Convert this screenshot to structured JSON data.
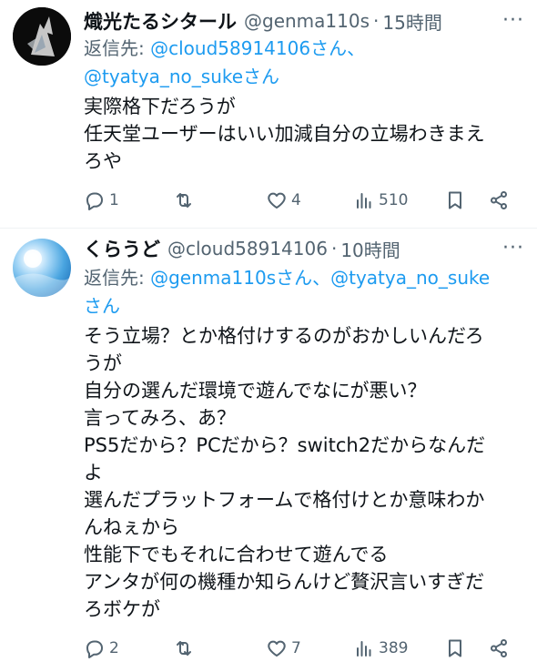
{
  "tweets": [
    {
      "name": "熾光たるシタール",
      "handle": "@genma110s",
      "separator": "·",
      "time": "15時間",
      "more": "···",
      "reply_to_prefix": "返信先: ",
      "mentions": [
        "@cloud58914106さん、",
        "@tyatya_no_sukeさん"
      ],
      "body_lines": [
        "実際格下だろうが",
        "任天堂ユーザーはいい加減自分の立場わきまえ",
        "ろや"
      ],
      "stats": {
        "replies": "1",
        "retweets": "",
        "likes": "4",
        "views": "510"
      },
      "avatar_icon": "dark-anime-character-avatar"
    },
    {
      "name": "くらうど",
      "handle": "@cloud58914106",
      "separator": "·",
      "time": "10時間",
      "more": "···",
      "reply_to_prefix": "返信先: ",
      "mentions": [
        "@genma110sさん、",
        "@tyatya_no_suke",
        "さん"
      ],
      "body_lines": [
        "そう立場？とか格付けするのがおかしいんだろ",
        "うが",
        "自分の選んだ環境で遊んでなにが悪い？",
        "言ってみろ、あ？",
        "PS5だから？PCだから？switch2だからなんだ",
        "よ",
        "選んだプラットフォームで格付けとか意味わか",
        "んねぇから",
        "性能下でもそれに合わせて遊んでる",
        "アンタが何の機種か知らんけど贅沢言いすぎだ",
        "ろボケが"
      ],
      "stats": {
        "replies": "2",
        "retweets": "",
        "likes": "7",
        "views": "389"
      },
      "avatar_icon": "blue-sky-avatar"
    }
  ],
  "icons": [
    "reply-icon",
    "retweet-icon",
    "like-icon",
    "views-icon",
    "bookmark-icon",
    "share-icon",
    "more-icon"
  ],
  "colors": {
    "text": "#0f1419",
    "secondary": "#536471",
    "link": "#1d9bf0",
    "divider": "#eff3f4"
  }
}
